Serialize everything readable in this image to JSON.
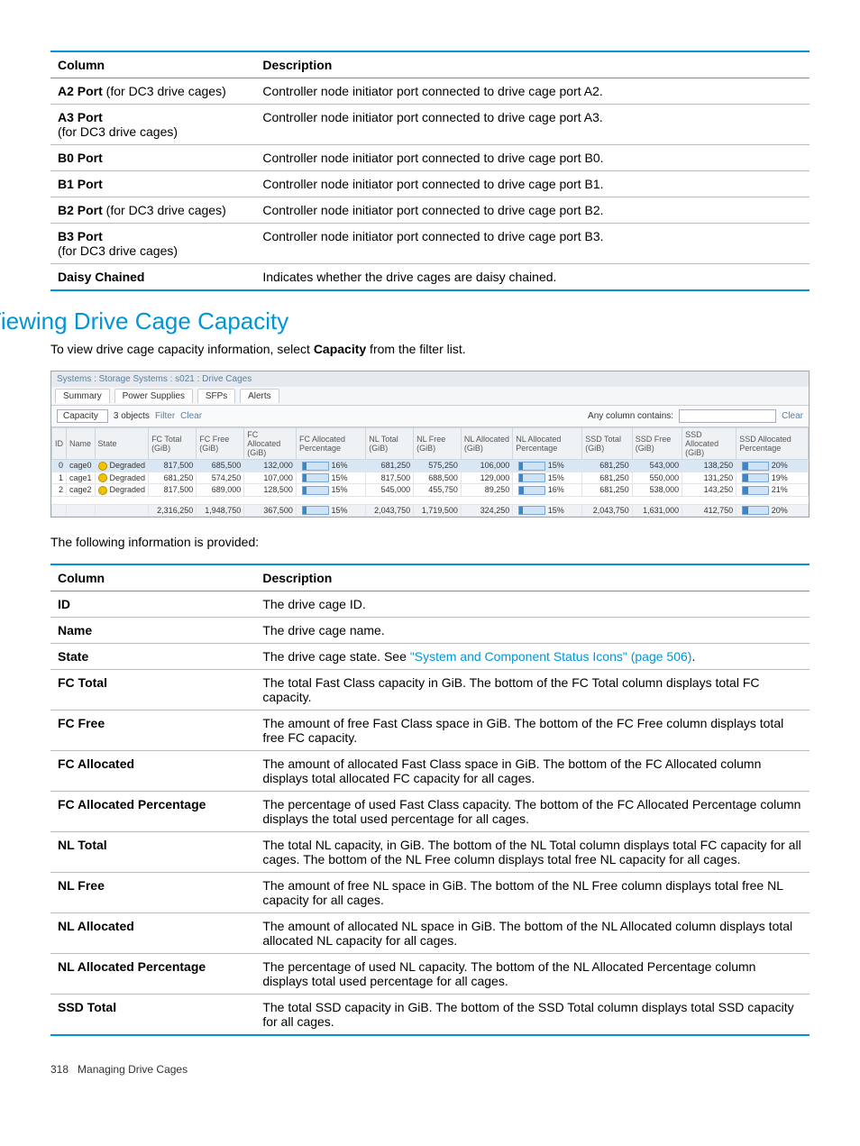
{
  "table1": {
    "headers": [
      "Column",
      "Description"
    ],
    "rows": [
      {
        "c1b": "A2 Port",
        "c1n": " (for DC3 drive cages)",
        "c2": "Controller node initiator port connected to drive cage port A2."
      },
      {
        "c1b": "A3 Port",
        "c1n": "\n(for DC3 drive cages)",
        "c2": "Controller node initiator port connected to drive cage port A3."
      },
      {
        "c1b": "B0 Port",
        "c1n": "",
        "c2": "Controller node initiator port connected to drive cage port B0."
      },
      {
        "c1b": "B1 Port",
        "c1n": "",
        "c2": "Controller node initiator port connected to drive cage port B1."
      },
      {
        "c1b": "B2 Port",
        "c1n": " (for DC3 drive cages)",
        "c2": "Controller node initiator port connected to drive cage port B2."
      },
      {
        "c1b": "B3 Port",
        "c1n": "\n(for DC3 drive cages)",
        "c2": "Controller node initiator port connected to drive cage port B3."
      },
      {
        "c1b": "Daisy Chained",
        "c1n": "",
        "c2": "Indicates whether the drive cages are daisy chained."
      }
    ]
  },
  "section_title": "Viewing Drive Cage Capacity",
  "intro_a": "To view drive cage capacity information, select ",
  "intro_b": "Capacity",
  "intro_c": " from the filter list.",
  "after_shot": "The following information is provided:",
  "shot": {
    "crumb": "Systems : Storage Systems : s021 : Drive Cages",
    "tabs": [
      "Summary",
      "Power Supplies",
      "SFPs",
      "Alerts"
    ],
    "toolbar": {
      "select": "Capacity",
      "objects": "3 objects",
      "filter": "Filter",
      "clear_small": "Clear",
      "any": "Any column contains:",
      "clear": "Clear"
    },
    "headers": [
      "ID",
      "Name",
      "State",
      "FC Total (GiB)",
      "FC Free (GiB)",
      "FC Allocated (GiB)",
      "FC Allocated Percentage",
      "NL Total (GiB)",
      "NL Free (GiB)",
      "NL Allocated (GiB)",
      "NL Allocated Percentage",
      "SSD Total (GiB)",
      "SSD Free (GiB)",
      "SSD Allocated (GiB)",
      "SSD Allocated Percentage"
    ],
    "rows": [
      {
        "id": "0",
        "name": "cage0",
        "state": "Degraded",
        "fct": "817,500",
        "fcf": "685,500",
        "fca": "132,000",
        "fcp": "16%",
        "nlt": "681,250",
        "nlf": "575,250",
        "nla": "106,000",
        "nlp": "15%",
        "sst": "681,250",
        "ssf": "543,000",
        "ssa": "138,250",
        "ssp": "20%",
        "sel": true
      },
      {
        "id": "1",
        "name": "cage1",
        "state": "Degraded",
        "fct": "681,250",
        "fcf": "574,250",
        "fca": "107,000",
        "fcp": "15%",
        "nlt": "817,500",
        "nlf": "688,500",
        "nla": "129,000",
        "nlp": "15%",
        "sst": "681,250",
        "ssf": "550,000",
        "ssa": "131,250",
        "ssp": "19%"
      },
      {
        "id": "2",
        "name": "cage2",
        "state": "Degraded",
        "fct": "817,500",
        "fcf": "689,000",
        "fca": "128,500",
        "fcp": "15%",
        "nlt": "545,000",
        "nlf": "455,750",
        "nla": "89,250",
        "nlp": "16%",
        "sst": "681,250",
        "ssf": "538,000",
        "ssa": "143,250",
        "ssp": "21%"
      }
    ],
    "totals": {
      "fct": "2,316,250",
      "fcf": "1,948,750",
      "fca": "367,500",
      "fcp": "15%",
      "nlt": "2,043,750",
      "nlf": "1,719,500",
      "nla": "324,250",
      "nlp": "15%",
      "sst": "2,043,750",
      "ssf": "1,631,000",
      "ssa": "412,750",
      "ssp": "20%"
    }
  },
  "table2": {
    "headers": [
      "Column",
      "Description"
    ],
    "rows": [
      {
        "c": "ID",
        "d": "The drive cage ID."
      },
      {
        "c": "Name",
        "d": "The drive cage name."
      },
      {
        "c": "State",
        "d_pre": "The drive cage state. See ",
        "d_link": "\"System and Component Status Icons\" (page 506)",
        "d_post": "."
      },
      {
        "c": "FC Total",
        "d": "The total Fast Class capacity in GiB. The bottom of the FC Total column displays total FC capacity."
      },
      {
        "c": "FC Free",
        "d": "The amount of free Fast Class space in GiB. The bottom of the FC Free column displays total free FC capacity."
      },
      {
        "c": "FC Allocated",
        "d": "The amount of allocated Fast Class space in GiB. The bottom of the FC Allocated column displays total allocated FC capacity for all cages."
      },
      {
        "c": "FC Allocated Percentage",
        "d": "The percentage of used Fast Class capacity. The bottom of the FC Allocated Percentage column displays the total used percentage for all cages."
      },
      {
        "c": "NL Total",
        "d": "The total NL capacity, in GiB. The bottom of the NL Total column displays total FC capacity for all cages. The bottom of the NL Free column displays total free NL capacity for all cages."
      },
      {
        "c": "NL Free",
        "d": "The amount of free NL space in GiB. The bottom of the NL Free column displays total free NL capacity for all cages."
      },
      {
        "c": "NL Allocated",
        "d": "The amount of allocated NL space in GiB. The bottom of the NL Allocated column displays total allocated NL capacity for all cages."
      },
      {
        "c": "NL Allocated Percentage",
        "d": "The percentage of used NL capacity. The bottom of the NL Allocated Percentage column displays total used percentage for all cages."
      },
      {
        "c": "SSD Total",
        "d": "The total SSD capacity in GiB. The bottom of the SSD Total column displays total SSD capacity for all cages."
      }
    ]
  },
  "footer": {
    "page": "318",
    "title": "Managing Drive Cages"
  }
}
